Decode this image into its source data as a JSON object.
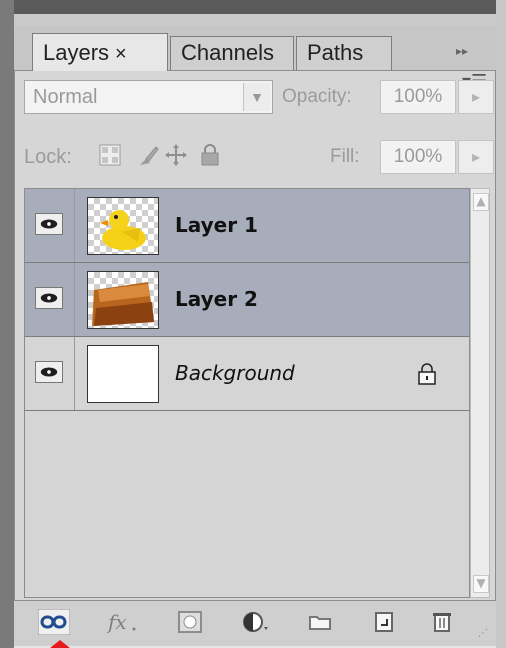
{
  "tabs": [
    {
      "label": "Layers",
      "close": "×"
    },
    {
      "label": "Channels"
    },
    {
      "label": "Paths"
    }
  ],
  "panel_controls": {
    "collapse_glyph": "▸▸",
    "menu_glyph": "▾☰"
  },
  "blend": {
    "mode": "Normal"
  },
  "opacity": {
    "label": "Opacity:",
    "value": "100%"
  },
  "lock": {
    "label": "Lock:"
  },
  "fill": {
    "label": "Fill:",
    "value": "100%"
  },
  "layers": [
    {
      "name": "Layer 1",
      "selected": true,
      "visible": true,
      "thumbnail": "rubber-duck"
    },
    {
      "name": "Layer 2",
      "selected": true,
      "visible": true,
      "thumbnail": "orange-texture"
    },
    {
      "name": "Background",
      "selected": false,
      "visible": true,
      "thumbnail": "white",
      "locked": true
    }
  ],
  "footer_tools": [
    "link-layers",
    "layer-style-fx",
    "layer-mask",
    "adjustment-layer",
    "new-group",
    "new-layer",
    "delete-layer"
  ],
  "colors": {
    "selected_row": "#a8adbc",
    "panel_bg": "#d6d6d6",
    "marker": "#e31b1b"
  }
}
